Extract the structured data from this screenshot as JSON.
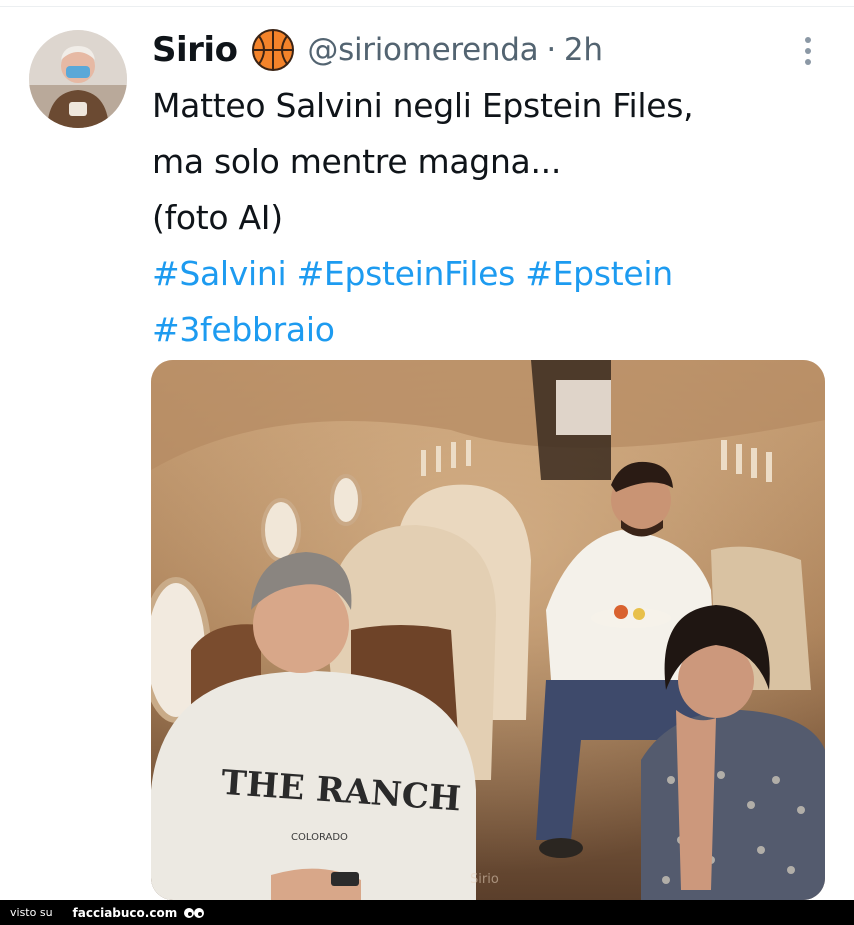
{
  "tweet": {
    "author_name": "Sirio",
    "handle": "@siriomerenda",
    "separator": "·",
    "time": "2h",
    "badge_icon": "basketball-icon",
    "text_lines": [
      "Matteo Salvini negli Epstein Files,",
      "ma solo mentre magna...",
      "(foto AI)"
    ],
    "hashtags_line1": [
      "#Salvini",
      "#EpsteinFiles",
      "#Epstein"
    ],
    "hashtags_line2": [
      "#3febbraio"
    ],
    "hashtag_color": "#1d9bf0",
    "media_watermark": "Sirio",
    "sweater_text": "THE RANCH",
    "sweater_subtext": "COLORADO"
  },
  "footer": {
    "visto_label": "visto su",
    "site_label": "facciabuco.com",
    "logo_icon": "eyes-icon"
  }
}
